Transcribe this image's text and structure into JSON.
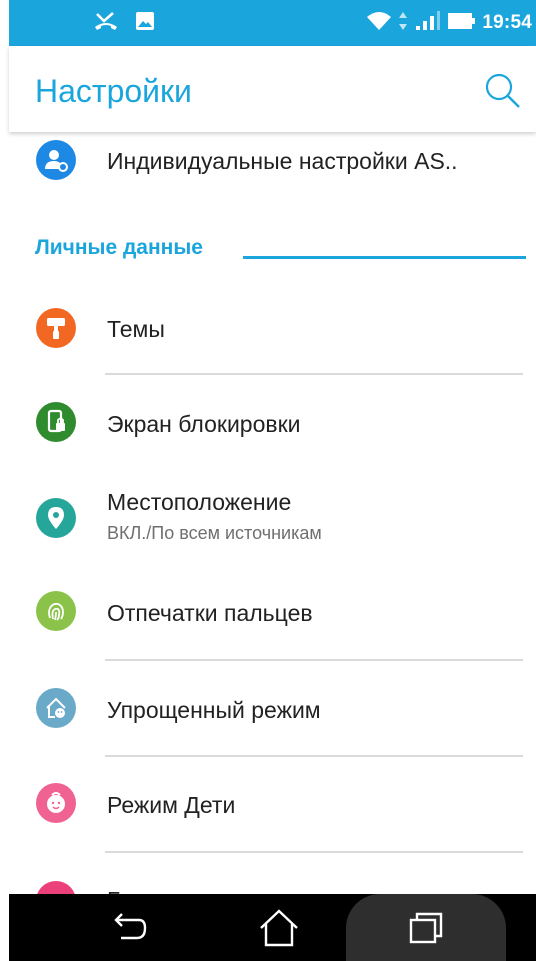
{
  "status_bar": {
    "time": "19:54",
    "icons": [
      "missed-call-icon",
      "image-icon",
      "wifi-icon",
      "data-arrows-icon",
      "signal-icon",
      "battery-icon"
    ],
    "color": "#1aa6dd"
  },
  "app_bar": {
    "title": "Настройки",
    "search_icon": "search-icon"
  },
  "items_top": {
    "asus_custom": {
      "title": "Индивидуальные настройки AS..",
      "icon": "user-gear-icon",
      "icon_color": "#1e88e5"
    }
  },
  "section": {
    "label": "Личные данные"
  },
  "items": [
    {
      "title": "Темы",
      "icon": "paint-roller-icon",
      "icon_color": "#f26722"
    },
    {
      "title": "Экран блокировки",
      "icon": "phone-lock-icon",
      "icon_color": "#2e8b2e"
    },
    {
      "title": "Местоположение",
      "subtitle": "ВКЛ./По всем источникам",
      "icon": "location-pin-icon",
      "icon_color": "#26a69a"
    },
    {
      "title": "Отпечатки пальцев",
      "icon": "fingerprint-icon",
      "icon_color": "#8bc34a"
    },
    {
      "title": "Упрощенный режим",
      "icon": "easy-mode-home-icon",
      "icon_color": "#6aa9c8"
    },
    {
      "title": "Режим Дети",
      "icon": "kid-face-icon",
      "icon_color": "#f06292"
    },
    {
      "title": "Б",
      "icon": "partial-item-icon",
      "icon_color": "#ec407a"
    }
  ],
  "nav_bar": {
    "back_icon": "back-icon",
    "home_icon": "home-icon",
    "recents_icon": "recents-icon"
  }
}
